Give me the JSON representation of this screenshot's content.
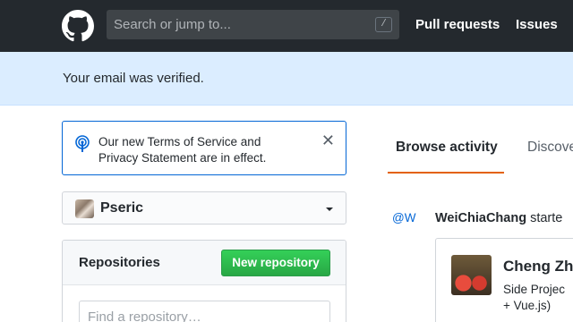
{
  "header": {
    "search_placeholder": "Search or jump to...",
    "search_shortcut": "/",
    "nav": {
      "pull_requests": "Pull requests",
      "issues": "Issues"
    }
  },
  "flash": {
    "message": "Your email was verified."
  },
  "notice": {
    "line1": "Our new Terms of Service and",
    "line2": "Privacy Statement are in effect.",
    "close": "✕"
  },
  "account": {
    "name": "Pseric"
  },
  "repositories": {
    "title": "Repositories",
    "new_button": "New repository",
    "find_placeholder": "Find a repository…"
  },
  "tabs": {
    "browse": "Browse activity",
    "discover": "Discove"
  },
  "feed": {
    "mention": "@W",
    "user": "WeiChiaChang",
    "action": " starte",
    "card_name": "Cheng Zh",
    "card_desc_line1": "Side Projec",
    "card_desc_line2": "+ Vue.js)"
  },
  "colors": {
    "header_bg": "#24292e",
    "flash_bg": "#dbedff",
    "accent_orange": "#e36209",
    "button_green": "#28a745",
    "link_blue": "#0366d6"
  },
  "icons": {
    "logo": "github-octocat-icon",
    "notice": "broadcast-icon",
    "caret": "caret-down-icon",
    "close": "close-icon"
  }
}
